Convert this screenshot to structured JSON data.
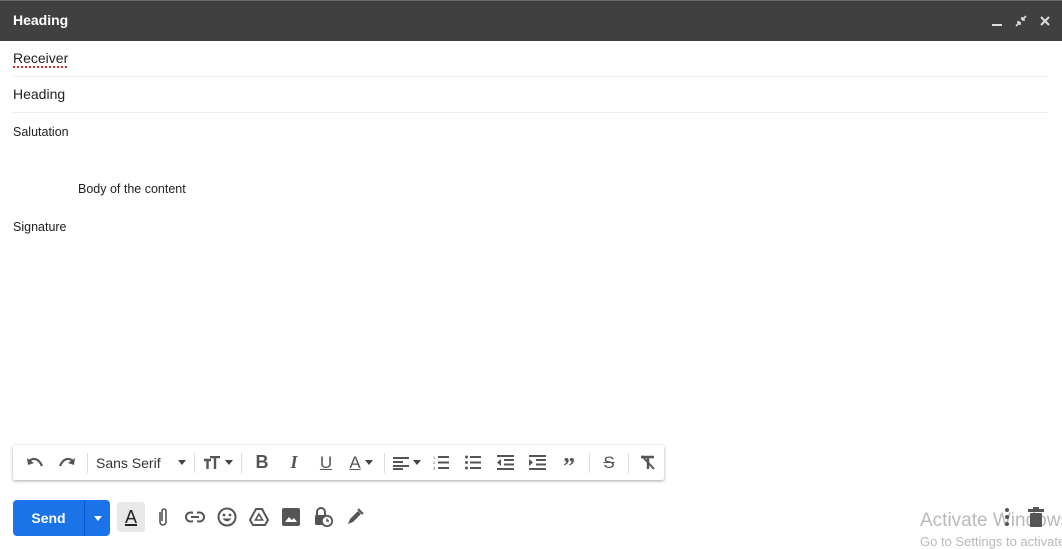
{
  "window": {
    "title": "Heading",
    "controls": [
      "minimize-icon",
      "exit-fullscreen-icon",
      "close-icon"
    ]
  },
  "fields": {
    "receiver": "Receiver",
    "subject": "Heading"
  },
  "body": {
    "salutation": "Salutation",
    "content": "Body of the content",
    "signature": "Signature"
  },
  "format_toolbar": {
    "font": "Sans Serif",
    "buttons": [
      "undo",
      "redo",
      "font-size",
      "bold",
      "italic",
      "underline",
      "text-color",
      "align",
      "numbered-list",
      "bulleted-list",
      "indent-less",
      "indent-more",
      "quote",
      "strikethrough",
      "remove-formatting"
    ]
  },
  "bottom_bar": {
    "send_label": "Send",
    "icons": [
      "formatting-options",
      "attach-file",
      "insert-link",
      "insert-emoji",
      "insert-drive-file",
      "insert-photo",
      "confidential-mode",
      "insert-signature",
      "more-options",
      "discard-draft"
    ]
  },
  "watermark": {
    "line1": "Activate Windows",
    "line2": "Go to Settings to activate Windows."
  },
  "colors": {
    "titlebar": "#404040",
    "send": "#1a73e8"
  }
}
